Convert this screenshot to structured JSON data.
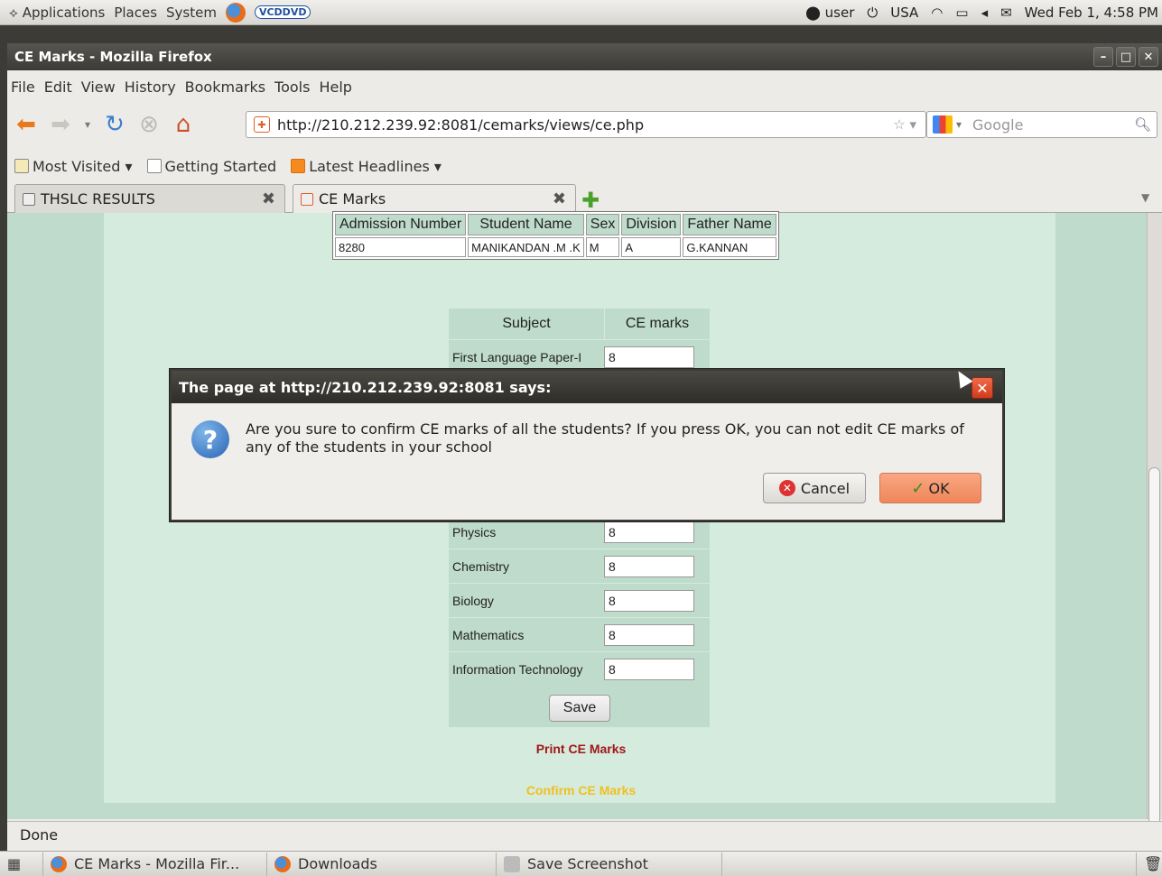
{
  "panel": {
    "menus": [
      "Applications",
      "Places",
      "System"
    ],
    "vcd": "VCDDVD",
    "user": "user",
    "keyboard": "USA",
    "clock": "Wed Feb  1,  4:58 PM"
  },
  "window": {
    "title": "CE Marks - Mozilla Firefox"
  },
  "menubar": [
    "File",
    "Edit",
    "View",
    "History",
    "Bookmarks",
    "Tools",
    "Help"
  ],
  "navbar": {
    "url": "http://210.212.239.92:8081/cemarks/views/ce.php",
    "search_placeholder": "Google"
  },
  "bookmarks": [
    "Most Visited ▾",
    "Getting Started",
    "Latest Headlines ▾"
  ],
  "tabs": [
    {
      "label": "THSLC RESULTS"
    },
    {
      "label": "CE Marks"
    }
  ],
  "student": {
    "headers": [
      "Admission Number",
      "Student Name",
      "Sex",
      "Division",
      "Father Name"
    ],
    "row": [
      "8280",
      "MANIKANDAN .M .K",
      "M",
      "A",
      "G.KANNAN"
    ]
  },
  "marks": {
    "headers": [
      "Subject",
      "CE marks"
    ],
    "rows": [
      {
        "subject": "First Language Paper-I",
        "mark": "8"
      },
      {
        "subject": "Physics",
        "mark": "8"
      },
      {
        "subject": "Chemistry",
        "mark": "8"
      },
      {
        "subject": "Biology",
        "mark": "8"
      },
      {
        "subject": "Mathematics",
        "mark": "8"
      },
      {
        "subject": "Information Technology",
        "mark": "8"
      }
    ],
    "save_label": "Save"
  },
  "links": {
    "print": "Print CE Marks",
    "confirm": "Confirm CE Marks"
  },
  "status": "Done",
  "dialog": {
    "title": "The page at http://210.212.239.92:8081 says:",
    "message": "Are you sure to confirm CE marks of all the students? If you press OK, you can not edit CE marks of any of the students in your school",
    "cancel_label": "Cancel",
    "ok_label": "OK"
  },
  "taskbar": [
    "CE Marks - Mozilla Fir...",
    "Downloads",
    "Save Screenshot"
  ]
}
